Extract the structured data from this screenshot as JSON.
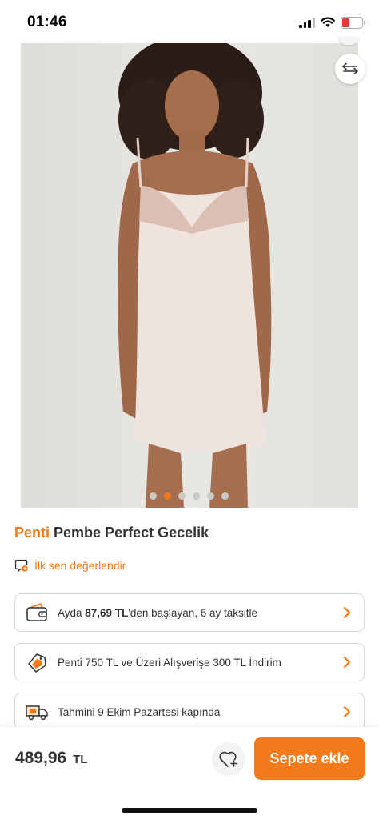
{
  "status_bar": {
    "time": "01:46",
    "battery": "6"
  },
  "gallery": {
    "image_count": 6,
    "active_index": 1
  },
  "product": {
    "brand": "Penti",
    "name": "Pembe Perfect Gecelik"
  },
  "rating": {
    "prompt": "İlk sen değerlendir"
  },
  "cards": {
    "installment": {
      "prefix": "Ayda ",
      "amount": "87,69 TL",
      "suffix": "'den başlayan, 6 ay taksitle"
    },
    "discount": {
      "text": "Penti 750 TL ve Üzeri Alışverişe 300 TL İndirim"
    },
    "delivery": {
      "text": "Tahmini 9 Ekim Pazartesi kapında"
    }
  },
  "footer": {
    "price": "489,96",
    "currency": "TL",
    "add_to_cart_label": "Sepete ekle"
  },
  "colors": {
    "accent": "#f27a1a",
    "text": "#333333",
    "border": "#d9d9d9"
  }
}
